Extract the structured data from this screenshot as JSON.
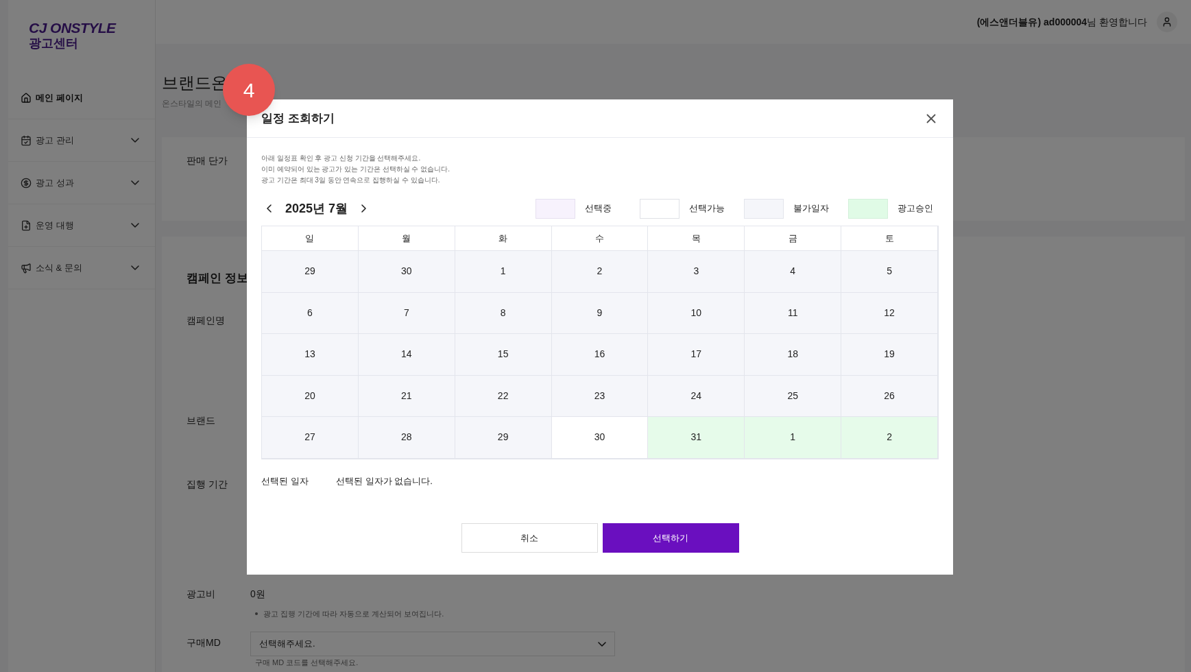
{
  "logo": {
    "brand": "CJ ONSTYLE",
    "subtitle": "광고센터"
  },
  "header": {
    "user": "(에스앤더블유) ad000004",
    "greeting": "님 환영합니다"
  },
  "sidebar": {
    "items": [
      {
        "label": "메인 페이지",
        "selected": true,
        "expandable": false
      },
      {
        "label": "광고 관리",
        "selected": false,
        "expandable": true
      },
      {
        "label": "광고 성과",
        "selected": false,
        "expandable": true
      },
      {
        "label": "운영 대행",
        "selected": false,
        "expandable": true
      },
      {
        "label": "소식 & 문의",
        "selected": false,
        "expandable": true
      }
    ]
  },
  "page": {
    "title": "브랜드온",
    "subtitle": "온스타일의 메인",
    "price_label": "판매 단가",
    "section_title": "캠페인 정보",
    "fields": [
      {
        "label": "캠페인명"
      },
      {
        "label": "브랜드"
      },
      {
        "label": "집행 기간"
      }
    ],
    "cost": {
      "label": "광고비",
      "value": "0원",
      "note": "광고 집행 기간에 따라 자동으로 계산되어 보여집니다."
    },
    "md": {
      "label": "구매MD",
      "placeholder": "선택해주세요.",
      "hint": "구매 MD 코드를 선택해주세요."
    }
  },
  "step_badge": "4",
  "modal": {
    "title": "일정 조회하기",
    "instructions": [
      "아래 일정표 확인 후 광고 신청 기간을 선택해주세요.",
      "이미 예약되어 있는 광고가 있는 기간은 선택하실 수 없습니다.",
      "광고 기간은 최대 3일 동안 연속으로 집행하실 수 있습니다."
    ],
    "month": "2025년 7월",
    "legend": [
      {
        "kind": "selecting",
        "label": "선택중"
      },
      {
        "kind": "available",
        "label": "선택가능"
      },
      {
        "kind": "unavailable",
        "label": "불가일자"
      },
      {
        "kind": "approved",
        "label": "광고승인"
      }
    ],
    "weekdays": [
      "일",
      "월",
      "화",
      "수",
      "목",
      "금",
      "토"
    ],
    "weeks": [
      [
        {
          "day": "29",
          "kind": "unavailable"
        },
        {
          "day": "30",
          "kind": "unavailable"
        },
        {
          "day": "1",
          "kind": "unavailable"
        },
        {
          "day": "2",
          "kind": "unavailable"
        },
        {
          "day": "3",
          "kind": "unavailable"
        },
        {
          "day": "4",
          "kind": "unavailable"
        },
        {
          "day": "5",
          "kind": "unavailable"
        }
      ],
      [
        {
          "day": "6",
          "kind": "unavailable"
        },
        {
          "day": "7",
          "kind": "unavailable"
        },
        {
          "day": "8",
          "kind": "unavailable"
        },
        {
          "day": "9",
          "kind": "unavailable"
        },
        {
          "day": "10",
          "kind": "unavailable"
        },
        {
          "day": "11",
          "kind": "unavailable"
        },
        {
          "day": "12",
          "kind": "unavailable"
        }
      ],
      [
        {
          "day": "13",
          "kind": "unavailable"
        },
        {
          "day": "14",
          "kind": "unavailable"
        },
        {
          "day": "15",
          "kind": "unavailable"
        },
        {
          "day": "16",
          "kind": "unavailable"
        },
        {
          "day": "17",
          "kind": "unavailable"
        },
        {
          "day": "18",
          "kind": "unavailable"
        },
        {
          "day": "19",
          "kind": "unavailable"
        }
      ],
      [
        {
          "day": "20",
          "kind": "unavailable"
        },
        {
          "day": "21",
          "kind": "unavailable"
        },
        {
          "day": "22",
          "kind": "unavailable"
        },
        {
          "day": "23",
          "kind": "unavailable"
        },
        {
          "day": "24",
          "kind": "unavailable"
        },
        {
          "day": "25",
          "kind": "unavailable"
        },
        {
          "day": "26",
          "kind": "unavailable"
        }
      ],
      [
        {
          "day": "27",
          "kind": "unavailable"
        },
        {
          "day": "28",
          "kind": "unavailable"
        },
        {
          "day": "29",
          "kind": "unavailable"
        },
        {
          "day": "30",
          "kind": "available"
        },
        {
          "day": "31",
          "kind": "approved"
        },
        {
          "day": "1",
          "kind": "approved"
        },
        {
          "day": "2",
          "kind": "approved"
        }
      ]
    ],
    "selected_label": "선택된 일자",
    "selected_value": "선택된 일자가 없습니다.",
    "buttons": [
      {
        "kind": "secondary",
        "label": "취소"
      },
      {
        "kind": "primary",
        "label": "선택하기"
      }
    ]
  }
}
